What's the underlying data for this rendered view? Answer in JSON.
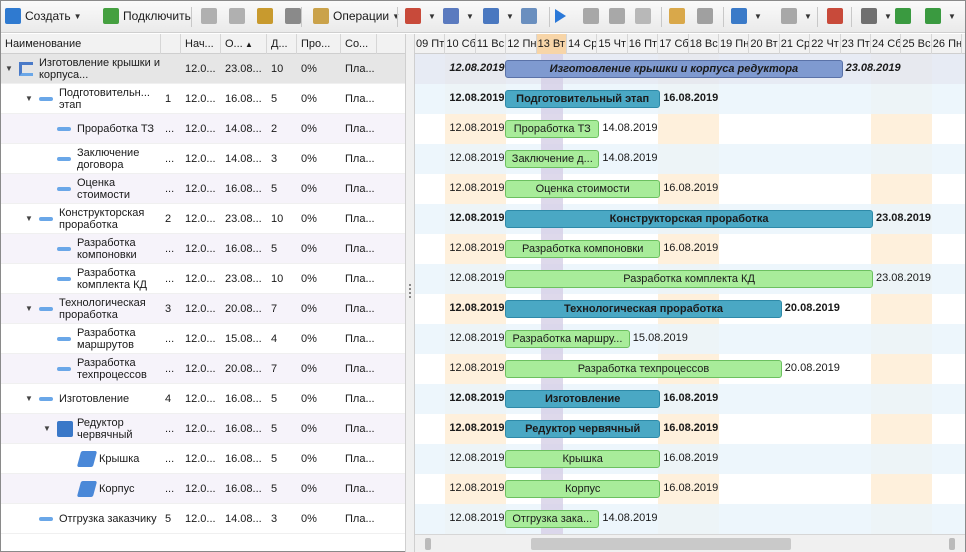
{
  "toolbar": {
    "items": [
      {
        "name": "create-button",
        "icon": "create-icon",
        "label": "Создать",
        "dropdown": true
      },
      {
        "name": "connect-button",
        "icon": "connect-icon",
        "label": "Подключить",
        "dropdown": false
      },
      {
        "name": "move-left-button",
        "icon": "double-left-icon",
        "label": "",
        "dropdown": false
      },
      {
        "name": "move-right-button",
        "icon": "double-right-icon",
        "label": "",
        "dropdown": false
      },
      {
        "name": "resource-button",
        "icon": "money-bag-icon",
        "label": "",
        "dropdown": false
      },
      {
        "name": "link-button",
        "icon": "chain-link-icon",
        "label": "",
        "dropdown": false
      },
      {
        "name": "operations-button",
        "icon": "operations-icon",
        "label": "Операции",
        "dropdown": true
      },
      {
        "name": "calendar-button",
        "icon": "calendar-icon",
        "label": "",
        "dropdown": true
      },
      {
        "name": "percent-button",
        "icon": "percent-icon",
        "label": "",
        "dropdown": true
      },
      {
        "name": "users-button",
        "icon": "users-icon",
        "label": "",
        "dropdown": true
      },
      {
        "name": "settings-button",
        "icon": "gear-icon",
        "label": "",
        "dropdown": false
      },
      {
        "name": "play-button",
        "icon": "play-icon",
        "label": "",
        "dropdown": false
      },
      {
        "name": "pause-button",
        "icon": "pause-icon",
        "label": "",
        "dropdown": false
      },
      {
        "name": "step-button",
        "icon": "step-icon",
        "label": "",
        "dropdown": false
      },
      {
        "name": "stop-button",
        "icon": "stop-icon",
        "label": "",
        "dropdown": false
      },
      {
        "name": "schedule-button",
        "icon": "schedule-icon",
        "label": "",
        "dropdown": false
      },
      {
        "name": "table-button",
        "icon": "table-icon",
        "label": "",
        "dropdown": false
      },
      {
        "name": "undo-button",
        "icon": "undo-icon",
        "label": "",
        "dropdown": true
      },
      {
        "name": "redo-button",
        "icon": "redo-icon",
        "label": "",
        "dropdown": true
      },
      {
        "name": "date-button",
        "icon": "calendar-12-icon",
        "label": "",
        "dropdown": false
      },
      {
        "name": "print-button",
        "icon": "printer-icon",
        "label": "",
        "dropdown": true
      },
      {
        "name": "zoom-in-button",
        "icon": "zoom-in-icon",
        "label": "",
        "dropdown": false
      },
      {
        "name": "zoom-out-button",
        "icon": "zoom-out-icon",
        "label": "",
        "dropdown": true
      }
    ]
  },
  "columns": [
    "Наименование",
    "",
    "Нач...",
    "О...",
    "Д...",
    "Про...",
    "Со..."
  ],
  "rows": [
    {
      "name": "Изготовление крышки и корпуса...",
      "num": "",
      "start": "12.0...",
      "end": "23.08...",
      "dur": "10",
      "pct": "0%",
      "st": "Пла...",
      "level": 0,
      "toggle": "▼",
      "icon": "tree-icon",
      "sel": true
    },
    {
      "name": "Подготовительн... этап",
      "num": "1",
      "start": "12.0...",
      "end": "16.08...",
      "dur": "5",
      "pct": "0%",
      "st": "Пла...",
      "level": 1,
      "toggle": "▼",
      "icon": "dash-icon"
    },
    {
      "name": "Проработка ТЗ",
      "num": "...",
      "start": "12.0...",
      "end": "14.08...",
      "dur": "2",
      "pct": "0%",
      "st": "Пла...",
      "level": 2,
      "toggle": "",
      "icon": "dash-icon"
    },
    {
      "name": "Заключение договора",
      "num": "...",
      "start": "12.0...",
      "end": "14.08...",
      "dur": "3",
      "pct": "0%",
      "st": "Пла...",
      "level": 2,
      "toggle": "",
      "icon": "dash-icon"
    },
    {
      "name": "Оценка стоимости",
      "num": "...",
      "start": "12.0...",
      "end": "16.08...",
      "dur": "5",
      "pct": "0%",
      "st": "Пла...",
      "level": 2,
      "toggle": "",
      "icon": "dash-icon"
    },
    {
      "name": "Конструкторская проработка",
      "num": "2",
      "start": "12.0...",
      "end": "23.08...",
      "dur": "10",
      "pct": "0%",
      "st": "Пла...",
      "level": 1,
      "toggle": "▼",
      "icon": "dash-icon"
    },
    {
      "name": "Разработка компоновки",
      "num": "...",
      "start": "12.0...",
      "end": "16.08...",
      "dur": "5",
      "pct": "0%",
      "st": "Пла...",
      "level": 2,
      "toggle": "",
      "icon": "dash-icon"
    },
    {
      "name": "Разработка комплекта КД",
      "num": "...",
      "start": "12.0...",
      "end": "23.08...",
      "dur": "10",
      "pct": "0%",
      "st": "Пла...",
      "level": 2,
      "toggle": "",
      "icon": "dash-icon"
    },
    {
      "name": "Технологическая проработка",
      "num": "3",
      "start": "12.0...",
      "end": "20.08...",
      "dur": "7",
      "pct": "0%",
      "st": "Пла...",
      "level": 1,
      "toggle": "▼",
      "icon": "dash-icon"
    },
    {
      "name": "Разработка маршрутов",
      "num": "...",
      "start": "12.0...",
      "end": "15.08...",
      "dur": "4",
      "pct": "0%",
      "st": "Пла...",
      "level": 2,
      "toggle": "",
      "icon": "dash-icon"
    },
    {
      "name": "Разработка техпроцессов",
      "num": "...",
      "start": "12.0...",
      "end": "20.08...",
      "dur": "7",
      "pct": "0%",
      "st": "Пла...",
      "level": 2,
      "toggle": "",
      "icon": "dash-icon"
    },
    {
      "name": "Изготовление",
      "num": "4",
      "start": "12.0...",
      "end": "16.08...",
      "dur": "5",
      "pct": "0%",
      "st": "Пла...",
      "level": 1,
      "toggle": "▼",
      "icon": "dash-icon"
    },
    {
      "name": "Редуктор червячный",
      "num": "...",
      "start": "12.0...",
      "end": "16.08...",
      "dur": "5",
      "pct": "0%",
      "st": "Пла...",
      "level": 2,
      "toggle": "▼",
      "icon": "assembly-icon"
    },
    {
      "name": "Крышка",
      "num": "...",
      "start": "12.0...",
      "end": "16.08...",
      "dur": "5",
      "pct": "0%",
      "st": "Пла...",
      "level": 3,
      "toggle": "",
      "icon": "part-icon"
    },
    {
      "name": "Корпус",
      "num": "...",
      "start": "12.0...",
      "end": "16.08...",
      "dur": "5",
      "pct": "0%",
      "st": "Пла...",
      "level": 3,
      "toggle": "",
      "icon": "part-icon"
    },
    {
      "name": "Отгрузка заказчику",
      "num": "5",
      "start": "12.0...",
      "end": "14.08...",
      "dur": "3",
      "pct": "0%",
      "st": "Пла...",
      "level": 1,
      "toggle": "",
      "icon": "dash-icon"
    }
  ],
  "timeline": {
    "days": [
      "09 Пт",
      "10 Сб",
      "11 Вс",
      "12 Пн",
      "13 Вт",
      "14 Ср",
      "15 Чт",
      "16 Пт",
      "17 Сб",
      "18 Вс",
      "19 Пн",
      "20 Вт",
      "21 Ср",
      "22 Чт",
      "23 Пт",
      "24 Сб",
      "25 Вс",
      "26 Пн"
    ],
    "today_index": 4
  },
  "gantt": [
    {
      "type": "project",
      "label": "Изготовление крышки и корпуса редуктора",
      "start_label": "12.08.2019",
      "end_label": "23.08.2019",
      "s": 3,
      "e": 14
    },
    {
      "type": "summary",
      "label": "Подготовительный этап",
      "start_label": "12.08.2019",
      "end_label": "16.08.2019",
      "s": 3,
      "e": 8
    },
    {
      "type": "task",
      "label": "Проработка ТЗ",
      "start_label": "12.08.2019",
      "end_label": "14.08.2019",
      "s": 3,
      "e": 6
    },
    {
      "type": "task",
      "label": "Заключение д...",
      "start_label": "12.08.2019",
      "end_label": "14.08.2019",
      "s": 3,
      "e": 6
    },
    {
      "type": "task",
      "label": "Оценка стоимости",
      "start_label": "12.08.2019",
      "end_label": "16.08.2019",
      "s": 3,
      "e": 8
    },
    {
      "type": "summary",
      "label": "Конструкторская проработка",
      "start_label": "12.08.2019",
      "end_label": "23.08.2019",
      "s": 3,
      "e": 15
    },
    {
      "type": "task",
      "label": "Разработка компоновки",
      "start_label": "12.08.2019",
      "end_label": "16.08.2019",
      "s": 3,
      "e": 8
    },
    {
      "type": "task",
      "label": "Разработка комплекта КД",
      "start_label": "12.08.2019",
      "end_label": "23.08.2019",
      "s": 3,
      "e": 15
    },
    {
      "type": "summary",
      "label": "Технологическая проработка",
      "start_label": "12.08.2019",
      "end_label": "20.08.2019",
      "s": 3,
      "e": 12
    },
    {
      "type": "task",
      "label": "Разработка маршру...",
      "start_label": "12.08.2019",
      "end_label": "15.08.2019",
      "s": 3,
      "e": 7
    },
    {
      "type": "task",
      "label": "Разработка техпроцессов",
      "start_label": "12.08.2019",
      "end_label": "20.08.2019",
      "s": 3,
      "e": 12
    },
    {
      "type": "summary",
      "label": "Изготовление",
      "start_label": "12.08.2019",
      "end_label": "16.08.2019",
      "s": 3,
      "e": 8
    },
    {
      "type": "summary",
      "label": "Редуктор червячный",
      "start_label": "12.08.2019",
      "end_label": "16.08.2019",
      "s": 3,
      "e": 8
    },
    {
      "type": "task",
      "label": "Крышка",
      "start_label": "12.08.2019",
      "end_label": "16.08.2019",
      "s": 3,
      "e": 8
    },
    {
      "type": "task",
      "label": "Корпус",
      "start_label": "12.08.2019",
      "end_label": "16.08.2019",
      "s": 3,
      "e": 8
    },
    {
      "type": "task",
      "label": "Отгрузка зака...",
      "start_label": "12.08.2019",
      "end_label": "14.08.2019",
      "s": 3,
      "e": 6
    }
  ],
  "colors": {
    "project_bar": "#7f9ad0",
    "summary_bar": "#4aa8c4",
    "task_bar": "#a8ec9a",
    "today_col": "#d6d0e6",
    "weekend_cols": "#fde6c4",
    "row_alt": "#eaf5fb",
    "row_sel": "#e3e7f2"
  }
}
